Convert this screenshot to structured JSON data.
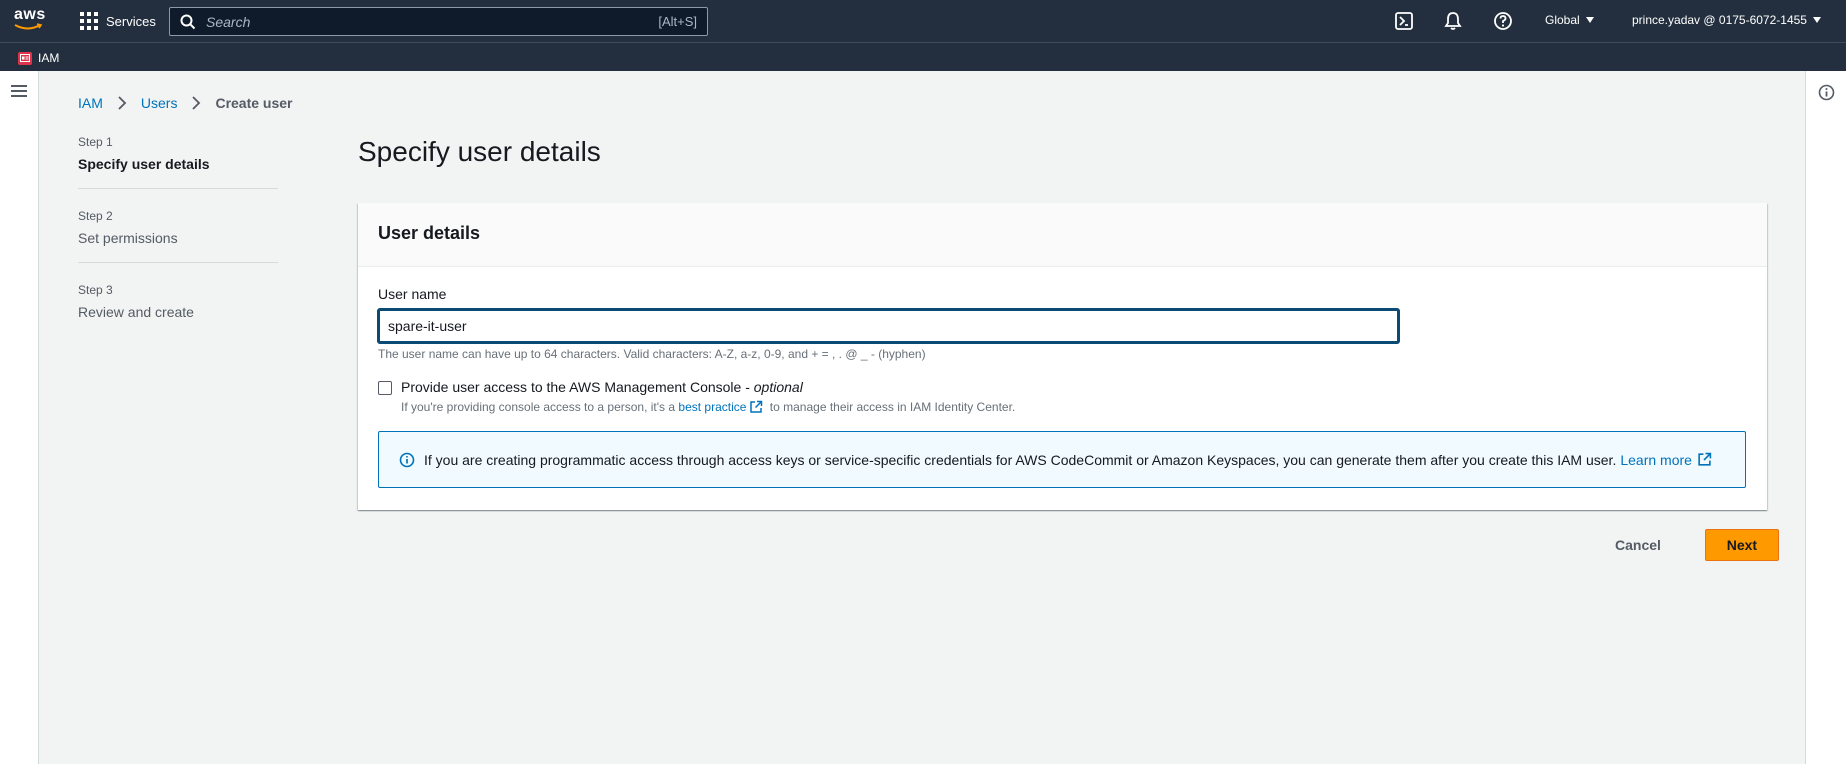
{
  "topnav": {
    "logo_text": "aws",
    "services_label": "Services",
    "search_placeholder": "Search",
    "search_shortcut": "[Alt+S]",
    "icons": [
      "cloudshell-icon",
      "bell-icon",
      "help-icon"
    ],
    "region_label": "Global",
    "account_label": "prince.yadav @ 0175-6072-1455"
  },
  "servicebar": {
    "favorite_label": "IAM"
  },
  "breadcrumb": {
    "items": [
      "IAM",
      "Users"
    ],
    "current": "Create user"
  },
  "steps": [
    {
      "num": "Step 1",
      "title": "Specify user details"
    },
    {
      "num": "Step 2",
      "title": "Set permissions"
    },
    {
      "num": "Step 3",
      "title": "Review and create"
    }
  ],
  "page_title": "Specify user details",
  "panel": {
    "title": "User details",
    "username_label": "User name",
    "username_value": "spare-it-user",
    "username_hint": "The user name can have up to 64 characters. Valid characters: A-Z, a-z, 0-9, and + = , . @ _ - (hyphen)",
    "console_label": "Provide user access to the AWS Management Console - ",
    "console_optional": "optional",
    "console_desc_before": "If you're providing console access to a person, it's a ",
    "console_desc_link": "best practice",
    "console_desc_after": " to manage their access in IAM Identity Center.",
    "alert_text": "If you are creating programmatic access through access keys or service-specific credentials for AWS CodeCommit or Amazon Keyspaces, you can generate them after you create this IAM user.",
    "alert_link": "Learn more"
  },
  "actions": {
    "cancel": "Cancel",
    "next": "Next"
  },
  "colors": {
    "nav_bg": "#232f3e",
    "link": "#0073bb",
    "primary_button": "#ff9900",
    "iam_badge": "#dd344c"
  }
}
